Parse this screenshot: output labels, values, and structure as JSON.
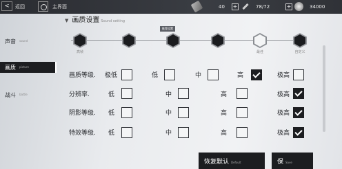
{
  "topbar": {
    "back_label": "返回",
    "home_label": "主界面",
    "resources": [
      {
        "icon": "chip-icon",
        "value": "40"
      },
      {
        "icon": "pen-icon",
        "value": "78/72"
      },
      {
        "icon": "coin-icon",
        "value": "34000"
      }
    ],
    "plus": "+"
  },
  "nav": [
    {
      "label": "声音",
      "sub": "sound"
    },
    {
      "label": "画质",
      "sub": "picture"
    },
    {
      "label": "战斗",
      "sub": "battle"
    }
  ],
  "section": {
    "title": "画质设置",
    "subtitle": "Sound setting",
    "triangle": "▼",
    "hint": "推荐设置"
  },
  "presets": [
    {
      "label": "高帧",
      "selected": false
    },
    {
      "label": "",
      "selected": false
    },
    {
      "label": "",
      "selected": false
    },
    {
      "label": "",
      "selected": false
    },
    {
      "label": "最佳",
      "selected": true
    },
    {
      "label": "自定义",
      "selected": false
    }
  ],
  "rows": [
    {
      "label": "画质等级.",
      "options": [
        {
          "label": "极低",
          "checked": false
        },
        {
          "label": "低",
          "checked": false
        },
        {
          "label": "中",
          "checked": false
        },
        {
          "label": "高",
          "checked": true
        },
        {
          "label": "极高",
          "checked": false
        }
      ]
    },
    {
      "label": "分辨率.",
      "options": [
        {
          "label": "低",
          "checked": false
        },
        {
          "label": "中",
          "checked": false
        },
        {
          "label": "高",
          "checked": false
        },
        {
          "label": "极高",
          "checked": true
        }
      ]
    },
    {
      "label": "阴影等级.",
      "options": [
        {
          "label": "低",
          "checked": false
        },
        {
          "label": "中",
          "checked": false
        },
        {
          "label": "高",
          "checked": false
        },
        {
          "label": "极高",
          "checked": true
        }
      ]
    },
    {
      "label": "特效等级.",
      "options": [
        {
          "label": "低",
          "checked": false
        },
        {
          "label": "中",
          "checked": false
        },
        {
          "label": "高",
          "checked": false
        },
        {
          "label": "极高",
          "checked": true
        }
      ]
    }
  ],
  "buttons": {
    "reset_label": "恢复默认",
    "reset_sub": "Default",
    "save_label": "保",
    "save_sub": "Save"
  }
}
